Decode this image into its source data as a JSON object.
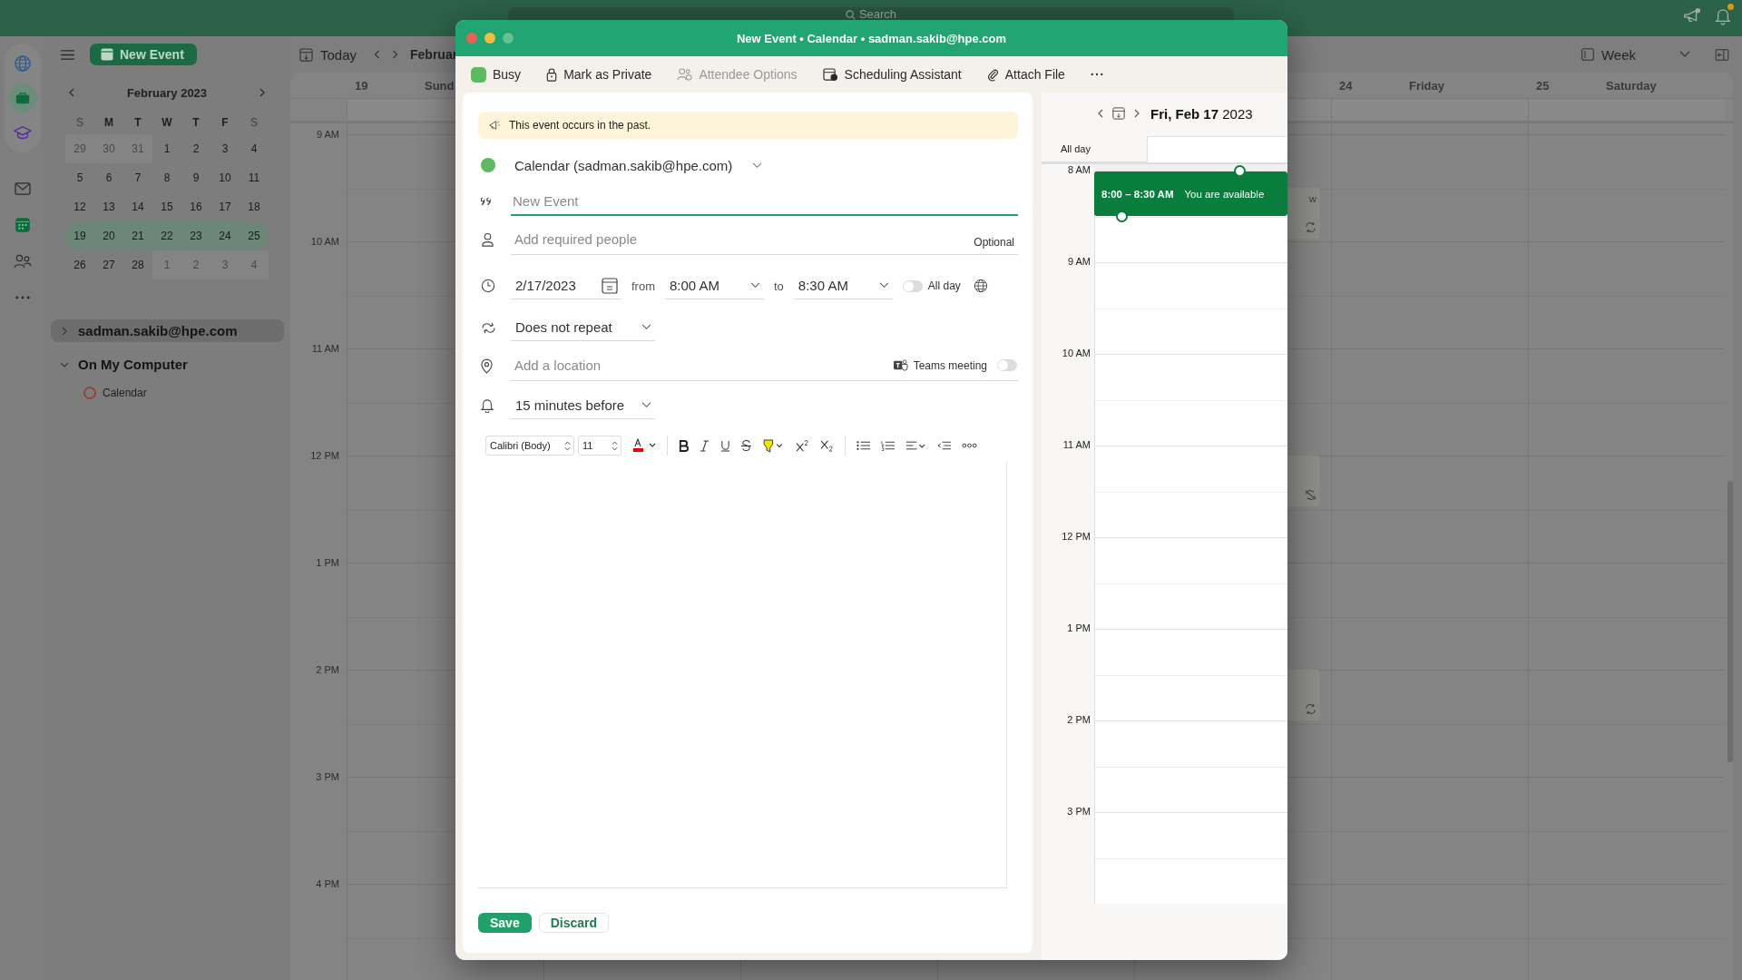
{
  "top_bar": {
    "search": {
      "placeholder": "Search"
    },
    "notifications": {
      "unread": true
    }
  },
  "rail": {
    "pinned": [
      {
        "kind": "globe",
        "selected": false
      },
      {
        "kind": "briefcase",
        "selected": true
      },
      {
        "kind": "cap",
        "selected": false
      }
    ],
    "apps": [
      {
        "kind": "mail",
        "selected": false
      },
      {
        "kind": "calendar",
        "selected": true
      },
      {
        "kind": "people",
        "selected": false
      },
      {
        "kind": "more",
        "selected": false
      }
    ]
  },
  "sidebar": {
    "new_event": "New Event",
    "mini_calendar": {
      "title": "February 2023",
      "weekdays": [
        "S",
        "M",
        "T",
        "W",
        "T",
        "F",
        "S"
      ],
      "weeks": [
        {
          "selected": false,
          "days": [
            {
              "label": "29",
              "outside": true
            },
            {
              "label": "30",
              "outside": true
            },
            {
              "label": "31",
              "outside": true
            },
            {
              "label": "1",
              "outside": false
            },
            {
              "label": "2",
              "outside": false
            },
            {
              "label": "3",
              "outside": false
            },
            {
              "label": "4",
              "outside": false
            }
          ]
        },
        {
          "selected": false,
          "days": [
            {
              "label": "5",
              "outside": false
            },
            {
              "label": "6",
              "outside": false
            },
            {
              "label": "7",
              "outside": false
            },
            {
              "label": "8",
              "outside": false
            },
            {
              "label": "9",
              "outside": false
            },
            {
              "label": "10",
              "outside": false
            },
            {
              "label": "11",
              "outside": false
            }
          ]
        },
        {
          "selected": false,
          "days": [
            {
              "label": "12",
              "outside": false
            },
            {
              "label": "13",
              "outside": false
            },
            {
              "label": "14",
              "outside": false
            },
            {
              "label": "15",
              "outside": false
            },
            {
              "label": "16",
              "outside": false
            },
            {
              "label": "17",
              "outside": false
            },
            {
              "label": "18",
              "outside": false
            }
          ]
        },
        {
          "selected": true,
          "days": [
            {
              "label": "19",
              "outside": false
            },
            {
              "label": "20",
              "outside": false
            },
            {
              "label": "21",
              "outside": false
            },
            {
              "label": "22",
              "outside": false
            },
            {
              "label": "23",
              "outside": false
            },
            {
              "label": "24",
              "outside": false
            },
            {
              "label": "25",
              "outside": false
            }
          ]
        },
        {
          "selected": false,
          "days": [
            {
              "label": "26",
              "outside": false
            },
            {
              "label": "27",
              "outside": false
            },
            {
              "label": "28",
              "outside": false
            },
            {
              "label": "1",
              "outside": true
            },
            {
              "label": "2",
              "outside": true
            },
            {
              "label": "3",
              "outside": true
            },
            {
              "label": "4",
              "outside": true
            }
          ]
        }
      ]
    },
    "folders": [
      {
        "label": "sadman.sakib@hpe.com",
        "expanded": false,
        "selected": true
      },
      {
        "label": "On My Computer",
        "expanded": true,
        "selected": false,
        "calendars": [
          {
            "label": "Calendar"
          }
        ]
      }
    ]
  },
  "toolbar": {
    "today": "Today",
    "month": "Februar",
    "view": "Week"
  },
  "week_view": {
    "columns": [
      {
        "number": "19",
        "name": "Sund"
      },
      {
        "number": "24",
        "name": "Friday"
      },
      {
        "number": "25",
        "name": "Saturday"
      }
    ],
    "events": [
      {
        "kind": "recurring",
        "label": "w"
      },
      {
        "kind": "exception"
      },
      {
        "kind": "recurring"
      }
    ],
    "hours": [
      "9 AM",
      "10 AM",
      "11 AM",
      "12 PM",
      "1 PM",
      "2 PM",
      "3 PM",
      "4 PM"
    ]
  },
  "dialog": {
    "title": "New Event • Calendar • sadman.sakib@hpe.com",
    "toolbar": [
      {
        "kind": "status",
        "label": "Busy",
        "disabled": false
      },
      {
        "kind": "private",
        "label": "Mark as Private",
        "disabled": false
      },
      {
        "kind": "attendees",
        "label": "Attendee Options",
        "disabled": true
      },
      {
        "kind": "scheduling",
        "label": "Scheduling Assistant",
        "disabled": false
      },
      {
        "kind": "attach",
        "label": "Attach File",
        "disabled": false
      },
      {
        "kind": "more",
        "disabled": false
      }
    ],
    "form": {
      "notice": "This event occurs in the past.",
      "calendar": "Calendar (sadman.sakib@hpe.com)",
      "title": {
        "placeholder": "New Event"
      },
      "people": {
        "placeholder": "Add required people",
        "optional": "Optional"
      },
      "date": "2/17/2023",
      "from_label": "from",
      "start": "8:00 AM",
      "to_label": "to",
      "end": "8:30 AM",
      "all_day": {
        "label": "All day",
        "on": false
      },
      "repeat": "Does not repeat",
      "location": {
        "placeholder": "Add a location"
      },
      "teams": {
        "label": "Teams meeting",
        "on": false
      },
      "reminder": "15 minutes before",
      "font": "Calibri (Body)",
      "font_size": "11"
    },
    "actions": {
      "save": "Save",
      "discard": "Discard"
    },
    "day_view": {
      "date": "**Fri, Feb 17** 2023",
      "all_day": "All day",
      "hours": [
        "8 AM",
        "9 AM",
        "10 AM",
        "11 AM",
        "12 PM",
        "1 PM",
        "2 PM",
        "3 PM"
      ],
      "event": {
        "time": "8:00 – 8:30 AM",
        "status": "You are available"
      }
    }
  }
}
